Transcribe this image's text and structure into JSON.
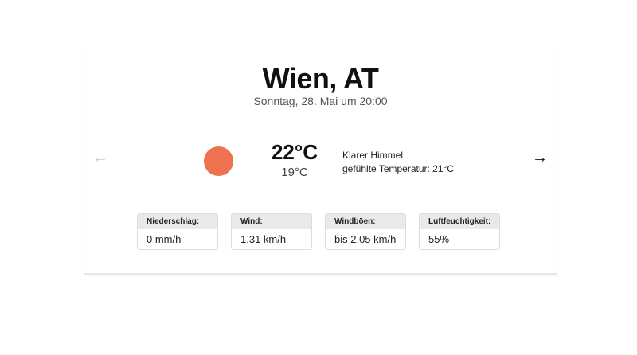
{
  "location": {
    "city": "Wien, AT",
    "datetime": "Sonntag, 28. Mai um 20:00"
  },
  "nav": {
    "prev_icon": "←",
    "next_icon": "→"
  },
  "current": {
    "icon": "sun-icon",
    "icon_color": "#ee7150",
    "temperature": "22°C",
    "temperature_low": "19°C",
    "condition": "Klarer Himmel",
    "feels_like": "gefühlte Temperatur: 21°C"
  },
  "stats": [
    {
      "label": "Niederschlag:",
      "value": "0 mm/h"
    },
    {
      "label": "Wind:",
      "value": "1.31 km/h"
    },
    {
      "label": "Windböen:",
      "value": "bis 2.05 km/h"
    },
    {
      "label": "Luftfeuchtigkeit:",
      "value": "55%"
    }
  ]
}
